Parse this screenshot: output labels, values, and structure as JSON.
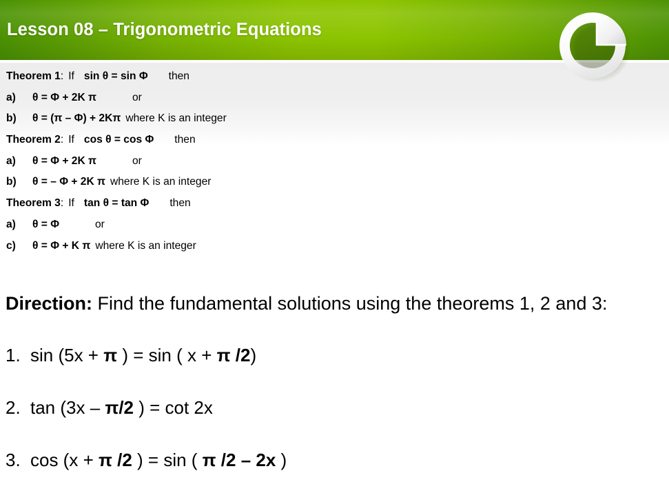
{
  "header": {
    "title": "Lesson 08 – Trigonometric Equations",
    "logo_icon": "pie-chart-ring-icon",
    "gradient_edge_color": "#4a9104",
    "gradient_center_color": "#8cc400",
    "title_color": "#ffffff"
  },
  "theorem_band": {
    "background_color": "#ededed",
    "lines": [
      {
        "kind": "heading",
        "label": "Theorem 1",
        "colon": ":",
        "if": "If",
        "equation": "sin θ = sin Φ",
        "then": "then"
      },
      {
        "kind": "item",
        "tag": "a)",
        "body": "θ = Φ +  2K π",
        "note": "or"
      },
      {
        "kind": "item",
        "tag": "b)",
        "body": "θ = (π – Φ) +  2Kπ",
        "note": "where K is an integer"
      },
      {
        "kind": "heading",
        "label": "Theorem 2",
        "colon": ":",
        "if": "If",
        "equation": "cos θ = cos Φ",
        "then": "then"
      },
      {
        "kind": "item",
        "tag": "a)",
        "body": "θ = Φ +  2K π",
        "note": "or"
      },
      {
        "kind": "item",
        "tag": "b)",
        "body": "θ = – Φ  +  2K π",
        "note": "where K is an integer"
      },
      {
        "kind": "heading",
        "label": "Theorem 3",
        "colon": ":",
        "if": "If",
        "equation": "tan θ = tan Φ",
        "then": "then"
      },
      {
        "kind": "item",
        "tag": "a)",
        "body": "θ = Φ",
        "note": "or"
      },
      {
        "kind": "item",
        "tag": "c)",
        "body": "θ = Φ  +  K π",
        "note": "where K is an integer"
      }
    ]
  },
  "direction": {
    "label": "Direction:",
    "text": " Find the fundamental solutions using the theorems 1, 2 and 3:"
  },
  "problems": [
    {
      "number": "1.",
      "p1": "sin (5x + ",
      "b1": "π",
      "p2": " )   = sin ( x  + ",
      "b2": "π /2",
      "p3": ")"
    },
    {
      "number": "2.",
      "p1": "tan (3x  – ",
      "b1": "π/2",
      "p2": " )   =  cot  2x",
      "b2": "",
      "p3": ""
    },
    {
      "number": "3.",
      "p1": "cos (x  + ",
      "b1": "π /2",
      "p2": " )   = sin ( ",
      "b2": "π /2 – 2x",
      "p3": " )"
    }
  ]
}
